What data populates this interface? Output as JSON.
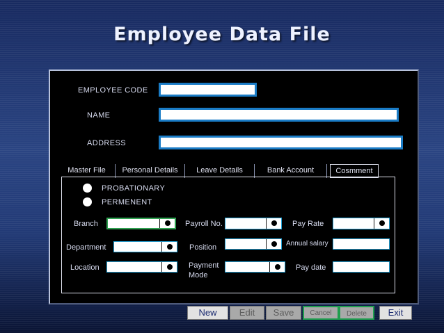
{
  "window": {
    "title": "Employee Data File"
  },
  "form": {
    "employee_code": {
      "label": "EMPLOYEE CODE",
      "value": ""
    },
    "name": {
      "label": "NAME",
      "value": ""
    },
    "address": {
      "label": "ADDRESS",
      "value": ""
    }
  },
  "tabs": [
    {
      "label": "Master File",
      "active": false
    },
    {
      "label": "Personal Details",
      "active": false
    },
    {
      "label": "Leave Details",
      "active": false
    },
    {
      "label": "Bank Account",
      "active": false
    },
    {
      "label": "Cosmment",
      "active": true
    }
  ],
  "status_options": [
    {
      "label": "PROBATIONARY"
    },
    {
      "label": "PERMENENT"
    }
  ],
  "details": {
    "branch": {
      "label": "Branch",
      "value": ""
    },
    "payroll_no": {
      "label": "Payroll No.",
      "value": ""
    },
    "pay_rate": {
      "label": "Pay Rate",
      "value": ""
    },
    "department": {
      "label": "Department",
      "value": ""
    },
    "position": {
      "label": "Position",
      "value": ""
    },
    "annual_salary": {
      "label": "Annual salary",
      "value": ""
    },
    "location": {
      "label": "Location",
      "value": ""
    },
    "payment_mode": {
      "label_line1": "Payment",
      "label_line2": "Mode",
      "value": ""
    },
    "pay_date": {
      "label": "Pay date",
      "value": ""
    }
  },
  "buttons": {
    "new": "New",
    "edit": "Edit",
    "save": "Save",
    "cancel": "Cancel",
    "delete": "Delete",
    "exit": "Exit"
  },
  "colors": {
    "background": "#1c2f66",
    "field_border": "#1a7cc6",
    "combo_border": "#25a4d8",
    "focus_border": "#2fa050"
  }
}
